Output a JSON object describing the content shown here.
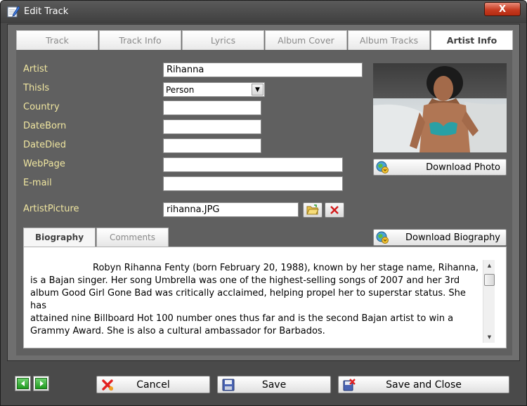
{
  "window": {
    "title": "Edit Track",
    "close_glyph": "X"
  },
  "tabs": [
    {
      "label": "Track"
    },
    {
      "label": "Track Info"
    },
    {
      "label": "Lyrics"
    },
    {
      "label": "Album Cover"
    },
    {
      "label": "Album Tracks"
    },
    {
      "label": "Artist Info",
      "active": true
    }
  ],
  "fields": {
    "artist": {
      "label": "Artist",
      "value": "Rihanna"
    },
    "thisis": {
      "label": "ThisIs",
      "value": "Person"
    },
    "country": {
      "label": "Country",
      "value": ""
    },
    "dateborn": {
      "label": "DateBorn",
      "value": ""
    },
    "datedied": {
      "label": "DateDied",
      "value": ""
    },
    "webpage": {
      "label": "WebPage",
      "value": ""
    },
    "email": {
      "label": "E-mail",
      "value": ""
    },
    "artistpicture": {
      "label": "ArtistPicture",
      "value": "rihanna.JPG"
    }
  },
  "buttons": {
    "download_photo": "Download Photo",
    "download_biography": "Download Biography",
    "cancel": "Cancel",
    "save": "Save",
    "save_and_close": "Save and Close"
  },
  "bio_tabs": [
    {
      "label": "Biography",
      "active": true
    },
    {
      "label": "Comments"
    }
  ],
  "biography": {
    "line1": "Robyn Rihanna Fenty (born February 20, 1988), known by her stage name, Rihanna,",
    "line2": "is a Bajan singer.  Her song Umbrella was one of the highest-selling songs of 2007 and her 3rd",
    "line3": "album Good Girl Gone Bad was critically acclaimed, helping propel her to superstar status. She has",
    "line4": "attained nine Billboard Hot 100 number ones thus far and is the second Bajan artist to win a",
    "line5": "Grammy Award. She is also a cultural ambassador for Barbados."
  },
  "icons": {
    "title": "edit-pencil-icon",
    "browse": "folder-open-icon",
    "clear": "red-x-icon",
    "globe": "globe-download-icon",
    "cancel": "cancel-x-icon",
    "save": "floppy-disk-icon",
    "save_close": "save-close-icon",
    "prev": "arrow-left-icon",
    "next": "arrow-right-icon"
  },
  "colors": {
    "label_text": "#f0e6a0",
    "window_bg": "#4a4a4a",
    "panel_bg": "#606060",
    "close_red": "#c73c22",
    "nav_green": "#1f9a1f"
  }
}
